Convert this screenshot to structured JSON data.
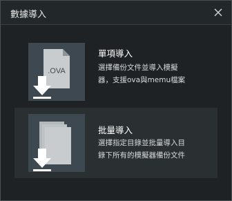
{
  "window": {
    "title": "數據導入"
  },
  "options": [
    {
      "title": "單項導入",
      "desc_line1": "選擇備份文件並導入模擬",
      "desc_line2": "器，支援ova與memu檔案",
      "file_badge": ".OVA",
      "icon": "ova-file-import-icon"
    },
    {
      "title": "批量導入",
      "desc_line1": "選擇指定目錄並批量導入目",
      "desc_line2": "錄下所有的模擬器備份文件",
      "icon": "multi-file-import-icon"
    }
  ],
  "colors": {
    "background": "#1e2224",
    "thumb_bg": "#3e4850",
    "hover_bg": "#2a2f32",
    "file_fill": "#c8ccce",
    "text": "#ffffff"
  }
}
